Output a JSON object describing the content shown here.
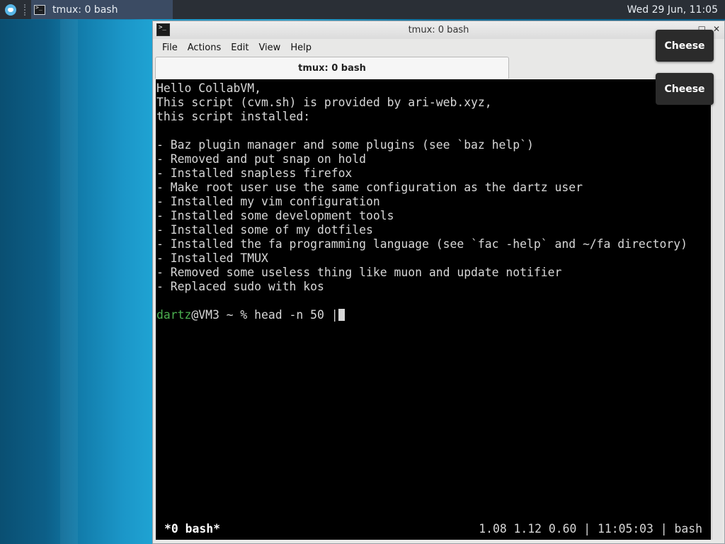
{
  "taskbar": {
    "task_label": "tmux: 0 bash",
    "clock": "Wed 29 Jun, 11:05"
  },
  "window": {
    "title": "tmux: 0 bash",
    "menus": [
      "File",
      "Actions",
      "Edit",
      "View",
      "Help"
    ],
    "tab_label": "tmux: 0 bash"
  },
  "terminal": {
    "lines": [
      "Hello CollabVM,",
      "This script (cvm.sh) is provided by ari-web.xyz,",
      "this script installed:",
      "",
      "- Baz plugin manager and some plugins (see `baz help`)",
      "- Removed and put snap on hold",
      "- Installed snapless firefox",
      "- Make root user use the same configuration as the dartz user",
      "- Installed my vim configuration",
      "- Installed some development tools",
      "- Installed some of my dotfiles",
      "- Installed the fa programming language (see `fac -help` and ~/fa directory)",
      "- Installed TMUX",
      "- Removed some useless thing like muon and update notifier",
      "- Replaced sudo with kos",
      ""
    ],
    "prompt_user": "dartz",
    "prompt_rest": "@VM3 ~ % ",
    "command": "head -n 50 |",
    "status_left": "*0 bash*",
    "status_right": "1.08 1.12 0.60 | 11:05:03 | bash"
  },
  "notifications": [
    "Cheese",
    "Cheese"
  ],
  "colors": {
    "prompt_user": "#4caf50",
    "terminal_bg": "#000000",
    "taskbar_bg": "#2a2f36"
  }
}
